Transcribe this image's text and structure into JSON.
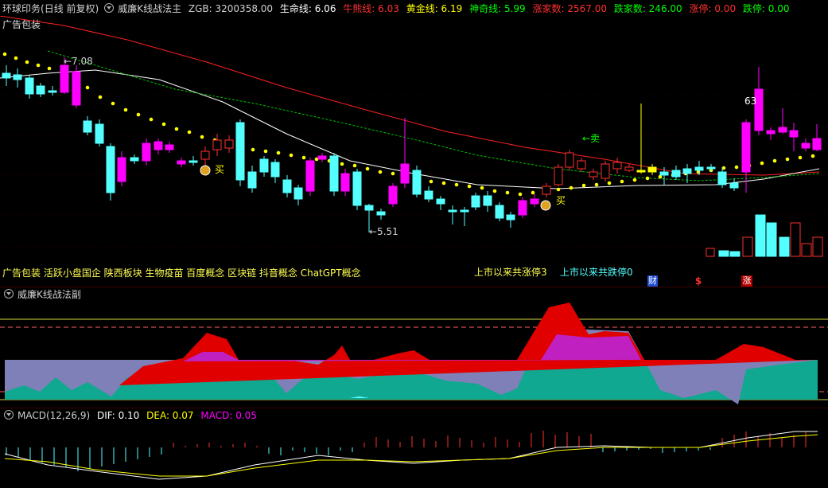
{
  "main_header": {
    "stock_name": "环球印务",
    "period": "(日线 前复权)",
    "indicator": "威廉K线战法主",
    "zgb": "ZGB: 3200358.00",
    "life_line": "生命线: 6.06",
    "bull_line": "牛熊线: 6.03",
    "gold_line": "黄金线: 6.19",
    "magic_line": "神奇线: 5.99",
    "up_count": "涨家数: 2567.00",
    "down_count": "跌家数: 246.00",
    "limit_up": "涨停: 0.00",
    "limit_down": "跌停: 0.00"
  },
  "main_panel": {
    "ad_label": "广告包装",
    "high_marker": "←7.08",
    "low_marker": "←5.51",
    "top_value": "63",
    "sell_label": "←卖",
    "buy_label": "买",
    "concepts": "广告包装 活跃小盘国企 陕西板块 生物疫苗 百度概念 区块链 抖音概念 ChatGPT概念",
    "limit_up_stat": "上市以来共涨停3",
    "limit_down_stat": "上市以来共跌停0",
    "badges": [
      "财",
      "$",
      "涨"
    ]
  },
  "sub_panel": {
    "title": "威廉K线战法副"
  },
  "macd_panel": {
    "title": "MACD(12,26,9)",
    "dif": "DIF: 0.10",
    "dea": "DEA: 0.07",
    "macd": "MACD: 0.05"
  },
  "colors": {
    "up": "#ff3030",
    "down": "#54ffff",
    "magenta": "#ff00ff",
    "yellow": "#ffff00",
    "green": "#00ff00",
    "white": "#ffffff"
  }
}
